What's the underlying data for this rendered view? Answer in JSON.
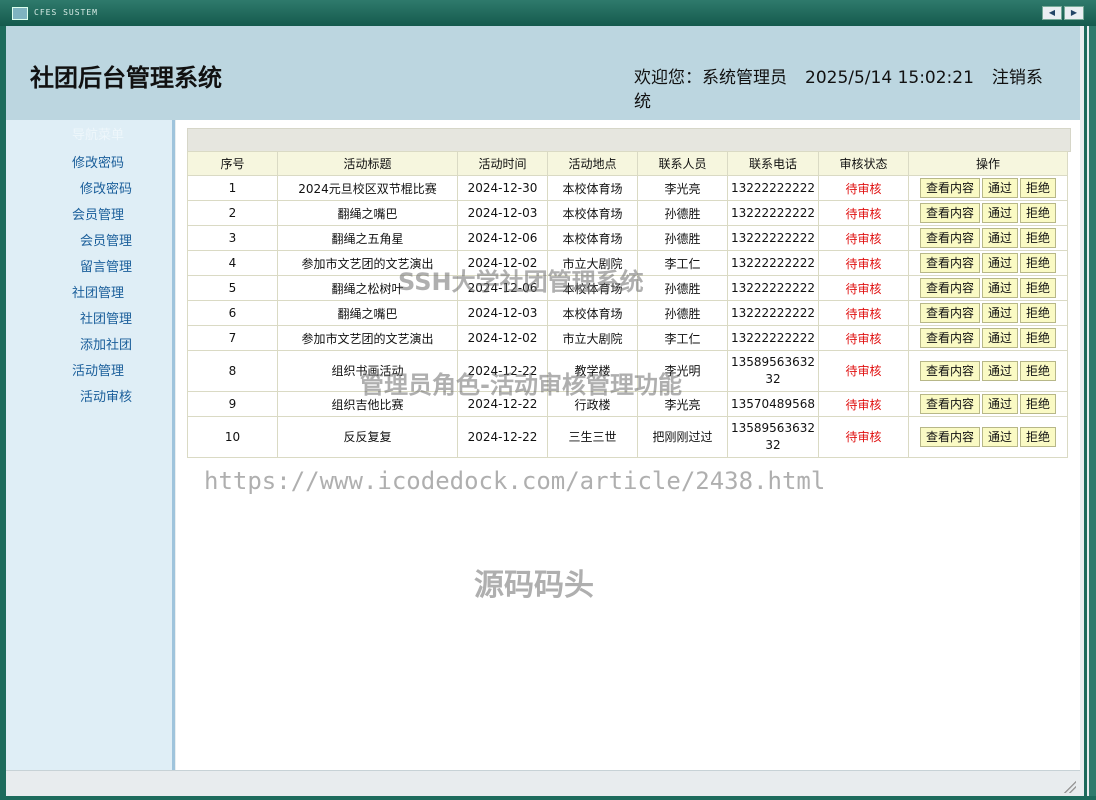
{
  "window": {
    "label": "CFES SUSTEM",
    "btn_prev": "◀",
    "btn_next": "▶"
  },
  "header": {
    "title": "社团后台管理系统",
    "welcome": "欢迎您：系统管理员",
    "datetime": "2025/5/14 15:02:21",
    "logout": "注销系统"
  },
  "sidebar": {
    "heading": "导航菜单",
    "items": [
      {
        "label": "修改密码"
      },
      {
        "label": "修改密码"
      },
      {
        "label": "会员管理"
      },
      {
        "label": "会员管理"
      },
      {
        "label": "留言管理"
      },
      {
        "label": "社团管理"
      },
      {
        "label": "社团管理"
      },
      {
        "label": "添加社团"
      },
      {
        "label": "活动管理"
      },
      {
        "label": "活动审核"
      }
    ]
  },
  "table": {
    "headers": [
      "序号",
      "活动标题",
      "活动时间",
      "活动地点",
      "联系人员",
      "联系电话",
      "审核状态",
      "操作"
    ],
    "action_view": "查看内容",
    "action_pass": "通过",
    "action_reject": "拒绝",
    "rows": [
      {
        "no": "1",
        "title": "2024元旦校区双节棍比赛",
        "date": "2024-12-30",
        "place": "本校体育场",
        "contact": "李光亮",
        "phone": "13222222222",
        "status": "待审核"
      },
      {
        "no": "2",
        "title": "翻绳之嘴巴",
        "date": "2024-12-03",
        "place": "本校体育场",
        "contact": "孙德胜",
        "phone": "13222222222",
        "status": "待审核"
      },
      {
        "no": "3",
        "title": "翻绳之五角星",
        "date": "2024-12-06",
        "place": "本校体育场",
        "contact": "孙德胜",
        "phone": "13222222222",
        "status": "待审核"
      },
      {
        "no": "4",
        "title": "参加市文艺团的文艺演出",
        "date": "2024-12-02",
        "place": "市立大剧院",
        "contact": "李工仁",
        "phone": "13222222222",
        "status": "待审核"
      },
      {
        "no": "5",
        "title": "翻绳之松树叶",
        "date": "2024-12-06",
        "place": "本校体育场",
        "contact": "孙德胜",
        "phone": "13222222222",
        "status": "待审核"
      },
      {
        "no": "6",
        "title": "翻绳之嘴巴",
        "date": "2024-12-03",
        "place": "本校体育场",
        "contact": "孙德胜",
        "phone": "13222222222",
        "status": "待审核"
      },
      {
        "no": "7",
        "title": "参加市文艺团的文艺演出",
        "date": "2024-12-02",
        "place": "市立大剧院",
        "contact": "李工仁",
        "phone": "13222222222",
        "status": "待审核"
      },
      {
        "no": "8",
        "title": "组织书画活动",
        "date": "2024-12-22",
        "place": "教学楼",
        "contact": "李光明",
        "phone": "1358956363232",
        "status": "待审核"
      },
      {
        "no": "9",
        "title": "组织吉他比赛",
        "date": "2024-12-22",
        "place": "行政楼",
        "contact": "李光亮",
        "phone": "13570489568",
        "status": "待审核"
      },
      {
        "no": "10",
        "title": "反反复复",
        "date": "2024-12-22",
        "place": "三生三世",
        "contact": "把刚刚过过",
        "phone": "1358956363232",
        "status": "待审核"
      }
    ]
  },
  "watermarks": {
    "line1": "SSH大学社团管理系统",
    "line2": "管理员角色-活动审核管理功能",
    "url": "https://www.icodedock.com/article/2438.html",
    "brand": "源码码头"
  }
}
